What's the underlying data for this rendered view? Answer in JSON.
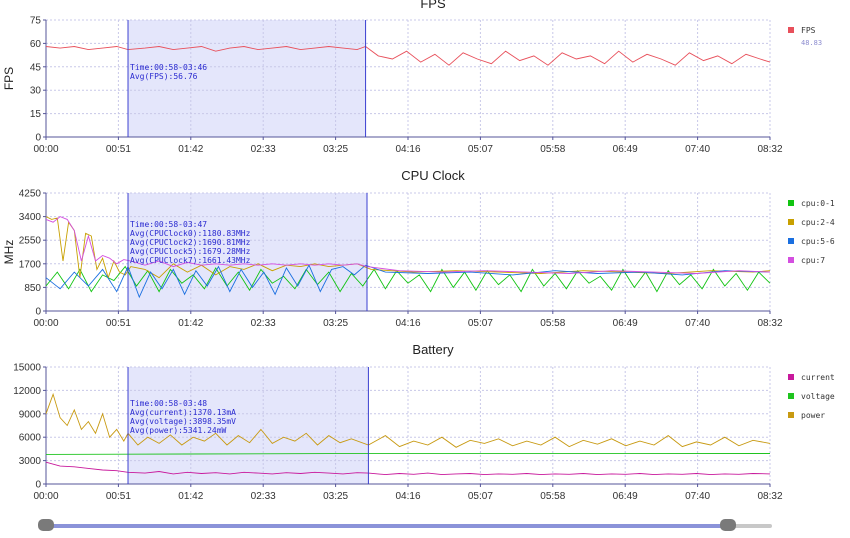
{
  "colors": {
    "fps": "#e8505b",
    "cpu01": "#11c411",
    "cpu24": "#c8a000",
    "cpu56": "#1a6fe0",
    "cpu7": "#d44fe0",
    "current": "#c8199c",
    "voltage": "#1fc41f",
    "power": "#c89a12",
    "selection_fill": "#e4e6fb",
    "selection_line": "#3a3fd0",
    "annotation_text": "#2a2ad0",
    "grid": "#c8c8e8",
    "axis": "#555599"
  },
  "time_ticks": [
    "00:00",
    "00:51",
    "01:42",
    "02:33",
    "03:25",
    "04:16",
    "05:07",
    "05:58",
    "06:49",
    "07:40",
    "08:32"
  ],
  "slider": {
    "start": 0.0,
    "end": 0.94
  },
  "chart_data": [
    {
      "type": "line",
      "title": "FPS",
      "ylabel": "FPS",
      "xlabel": "",
      "ylim": [
        0,
        75
      ],
      "yticks": [
        0,
        15,
        30,
        45,
        60,
        75
      ],
      "x_range_seconds": [
        0,
        512
      ],
      "selection_seconds": [
        58,
        226
      ],
      "annotation": [
        "Time:00:58-03:46",
        "Avg(FPS):56.76"
      ],
      "legend": [
        {
          "name": "FPS",
          "color_key": "fps",
          "value": "48.83"
        }
      ],
      "series": [
        {
          "name": "FPS",
          "color_key": "fps",
          "x": [
            0,
            10,
            20,
            30,
            40,
            50,
            58,
            70,
            80,
            90,
            100,
            110,
            120,
            130,
            140,
            150,
            160,
            170,
            180,
            190,
            200,
            210,
            220,
            226,
            235,
            245,
            255,
            265,
            275,
            285,
            295,
            305,
            315,
            325,
            335,
            345,
            355,
            365,
            375,
            385,
            395,
            405,
            415,
            425,
            435,
            445,
            455,
            465,
            475,
            485,
            495,
            505,
            512
          ],
          "y": [
            58,
            57,
            58,
            56,
            57,
            58,
            56,
            57,
            58,
            56,
            57,
            58,
            55,
            57,
            58,
            56,
            57,
            58,
            56,
            57,
            58,
            57,
            56,
            58,
            52,
            50,
            55,
            48,
            53,
            46,
            54,
            50,
            47,
            55,
            49,
            52,
            46,
            54,
            50,
            52,
            47,
            55,
            48,
            53,
            50,
            46,
            54,
            49,
            52,
            47,
            53,
            50,
            48
          ]
        }
      ]
    },
    {
      "type": "line",
      "title": "CPU Clock",
      "ylabel": "MHz",
      "xlabel": "",
      "ylim": [
        0,
        4250
      ],
      "yticks": [
        0,
        850,
        1700,
        2550,
        3400,
        4250
      ],
      "x_range_seconds": [
        0,
        512
      ],
      "selection_seconds": [
        58,
        227
      ],
      "annotation": [
        "Time:00:58-03:47",
        "Avg(CPUClock0):1180.83MHz",
        "Avg(CPUClock2):1690.81MHz",
        "Avg(CPUClock5):1679.28MHz",
        "Avg(CPUClock7):1661.43MHz"
      ],
      "legend": [
        {
          "name": "cpu:0-1",
          "color_key": "cpu01"
        },
        {
          "name": "cpu:2-4",
          "color_key": "cpu24"
        },
        {
          "name": "cpu:5-6",
          "color_key": "cpu56"
        },
        {
          "name": "cpu:7",
          "color_key": "cpu7"
        }
      ],
      "series": [
        {
          "name": "cpu:0-1",
          "color_key": "cpu01",
          "x": [
            0,
            8,
            16,
            24,
            32,
            40,
            48,
            56,
            64,
            72,
            80,
            88,
            96,
            104,
            112,
            120,
            128,
            136,
            144,
            152,
            160,
            168,
            176,
            184,
            192,
            200,
            208,
            216,
            224,
            232,
            240,
            248,
            256,
            264,
            272,
            280,
            288,
            296,
            304,
            312,
            320,
            328,
            336,
            344,
            352,
            360,
            368,
            376,
            384,
            392,
            400,
            408,
            416,
            424,
            432,
            440,
            448,
            456,
            464,
            472,
            480,
            488,
            496,
            504,
            512
          ],
          "y": [
            900,
            1400,
            800,
            1500,
            700,
            1300,
            1100,
            1600,
            900,
            1450,
            700,
            1500,
            1000,
            1300,
            800,
            1550,
            900,
            1400,
            750,
            1500,
            1000,
            1250,
            800,
            1500,
            950,
            1400,
            700,
            1350,
            900,
            1500,
            800,
            1450,
            1000,
            1300,
            700,
            1500,
            850,
            1400,
            750,
            1450,
            950,
            1300,
            700,
            1500,
            900,
            1350,
            800,
            1450,
            1000,
            1250,
            750,
            1500,
            850,
            1400,
            700,
            1450,
            950,
            1300,
            800,
            1500,
            900,
            1350,
            750,
            1400,
            1000
          ]
        },
        {
          "name": "cpu:2-4",
          "color_key": "cpu24",
          "x": [
            0,
            4,
            8,
            12,
            16,
            20,
            24,
            28,
            32,
            36,
            40,
            44,
            48,
            52,
            56,
            60,
            70,
            80,
            90,
            100,
            110,
            120,
            130,
            140,
            150,
            160,
            170,
            180,
            190,
            200,
            210,
            220,
            230,
            260,
            290,
            320,
            350,
            380,
            410,
            440,
            470,
            500,
            512
          ],
          "y": [
            3400,
            3300,
            3350,
            1800,
            3200,
            2900,
            1200,
            2800,
            2700,
            1500,
            1900,
            1200,
            1800,
            1400,
            1300,
            1600,
            1500,
            1200,
            1700,
            1400,
            1650,
            1300,
            1600,
            1500,
            1700,
            1450,
            1650,
            1600,
            1700,
            1600,
            1650,
            1700,
            1500,
            1400,
            1450,
            1400,
            1350,
            1450,
            1400,
            1350,
            1450,
            1400,
            1450
          ]
        },
        {
          "name": "cpu:5-6",
          "color_key": "cpu56",
          "x": [
            0,
            10,
            20,
            30,
            40,
            50,
            58,
            66,
            74,
            82,
            90,
            98,
            106,
            114,
            122,
            130,
            138,
            146,
            154,
            162,
            170,
            178,
            186,
            194,
            202,
            210,
            218,
            226,
            240,
            270,
            300,
            330,
            360,
            390,
            420,
            450,
            480,
            512
          ],
          "y": [
            1200,
            800,
            1400,
            900,
            1500,
            700,
            1600,
            500,
            1400,
            800,
            1500,
            600,
            1450,
            900,
            1600,
            700,
            1500,
            850,
            1400,
            600,
            1550,
            900,
            1650,
            700,
            1500,
            1600,
            1300,
            1650,
            1400,
            1350,
            1400,
            1300,
            1450,
            1350,
            1400,
            1300,
            1450,
            1400
          ]
        },
        {
          "name": "cpu:7",
          "color_key": "cpu7",
          "x": [
            0,
            5,
            10,
            15,
            20,
            25,
            30,
            35,
            40,
            45,
            50,
            55,
            60,
            70,
            80,
            90,
            100,
            110,
            120,
            130,
            140,
            150,
            160,
            170,
            180,
            190,
            200,
            210,
            220,
            227,
            250,
            280,
            310,
            340,
            370,
            400,
            430,
            460,
            490,
            512
          ],
          "y": [
            3300,
            3200,
            3400,
            3300,
            2900,
            1800,
            2700,
            1800,
            2000,
            1900,
            1700,
            1850,
            1800,
            1650,
            1800,
            1600,
            1750,
            1650,
            1700,
            1650,
            1700,
            1650,
            1700,
            1650,
            1700,
            1650,
            1700,
            1650,
            1700,
            1600,
            1450,
            1400,
            1450,
            1400,
            1350,
            1450,
            1400,
            1350,
            1450,
            1400
          ]
        }
      ]
    },
    {
      "type": "line",
      "title": "Battery",
      "ylabel": "",
      "xlabel": "",
      "ylim": [
        0,
        15000
      ],
      "yticks": [
        0,
        3000,
        6000,
        9000,
        12000,
        15000
      ],
      "x_range_seconds": [
        0,
        512
      ],
      "selection_seconds": [
        58,
        228
      ],
      "annotation": [
        "Time:00:58-03:48",
        "Avg(current):1370.13mA",
        "Avg(voltage):3898.35mV",
        "Avg(power):5341.24mW"
      ],
      "legend": [
        {
          "name": "current",
          "color_key": "current"
        },
        {
          "name": "voltage",
          "color_key": "voltage"
        },
        {
          "name": "power",
          "color_key": "power"
        }
      ],
      "series": [
        {
          "name": "current",
          "color_key": "current",
          "x": [
            0,
            10,
            20,
            30,
            40,
            50,
            58,
            70,
            80,
            90,
            100,
            110,
            120,
            130,
            140,
            150,
            160,
            170,
            180,
            190,
            200,
            210,
            220,
            228,
            240,
            250,
            260,
            270,
            280,
            290,
            300,
            310,
            320,
            330,
            340,
            350,
            360,
            370,
            380,
            390,
            400,
            410,
            420,
            430,
            440,
            450,
            460,
            470,
            480,
            490,
            500,
            512
          ],
          "y": [
            2800,
            2300,
            2200,
            2000,
            1800,
            1700,
            1500,
            1400,
            1600,
            1300,
            1500,
            1350,
            1450,
            1300,
            1500,
            1400,
            1300,
            1450,
            1350,
            1500,
            1400,
            1300,
            1450,
            1400,
            1200,
            1350,
            1250,
            1400,
            1200,
            1300,
            1350,
            1200,
            1300,
            1250,
            1350,
            1200,
            1300,
            1250,
            1350,
            1200,
            1300,
            1250,
            1350,
            1200,
            1300,
            1250,
            1350,
            1200,
            1300,
            1250,
            1350,
            1300
          ]
        },
        {
          "name": "voltage",
          "color_key": "voltage",
          "x": [
            0,
            100,
            200,
            300,
            400,
            512
          ],
          "y": [
            3800,
            3850,
            3900,
            3900,
            3900,
            3910
          ]
        },
        {
          "name": "power",
          "color_key": "power",
          "x": [
            0,
            5,
            10,
            15,
            20,
            25,
            30,
            35,
            40,
            45,
            50,
            55,
            58,
            65,
            72,
            80,
            88,
            96,
            104,
            112,
            120,
            128,
            136,
            144,
            152,
            160,
            168,
            176,
            184,
            192,
            200,
            208,
            216,
            228,
            240,
            250,
            260,
            270,
            280,
            290,
            300,
            310,
            320,
            330,
            340,
            350,
            360,
            370,
            380,
            390,
            400,
            410,
            420,
            430,
            440,
            450,
            460,
            470,
            480,
            490,
            500,
            512
          ],
          "y": [
            9000,
            11500,
            8500,
            7500,
            9500,
            7000,
            8000,
            6500,
            9000,
            6000,
            7000,
            5500,
            6500,
            5000,
            6000,
            5200,
            6300,
            5000,
            6000,
            5500,
            6500,
            5000,
            6200,
            5300,
            7000,
            5200,
            6000,
            5500,
            6500,
            5000,
            6200,
            5300,
            5800,
            5000,
            6200,
            4800,
            5500,
            5000,
            6000,
            4700,
            5600,
            5200,
            5800,
            4900,
            5500,
            5000,
            6000,
            4800,
            5600,
            5100,
            5800,
            4900,
            5500,
            5000,
            6200,
            4800,
            5400,
            5000,
            6000,
            4900,
            5600,
            5200
          ]
        }
      ]
    }
  ]
}
